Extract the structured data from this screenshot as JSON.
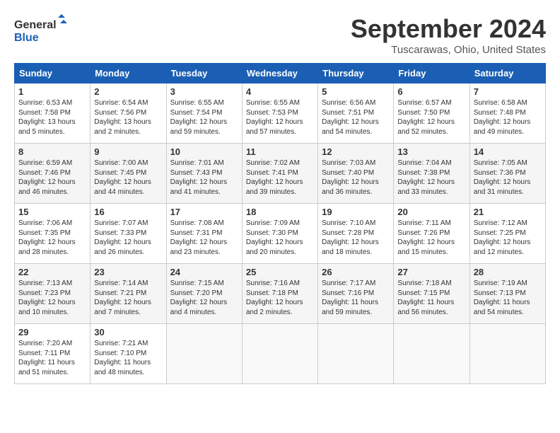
{
  "logo": {
    "line1": "General",
    "line2": "Blue"
  },
  "title": "September 2024",
  "location": "Tuscarawas, Ohio, United States",
  "days_of_week": [
    "Sunday",
    "Monday",
    "Tuesday",
    "Wednesday",
    "Thursday",
    "Friday",
    "Saturday"
  ],
  "weeks": [
    [
      {
        "day": "1",
        "info": "Sunrise: 6:53 AM\nSunset: 7:58 PM\nDaylight: 13 hours\nand 5 minutes."
      },
      {
        "day": "2",
        "info": "Sunrise: 6:54 AM\nSunset: 7:56 PM\nDaylight: 13 hours\nand 2 minutes."
      },
      {
        "day": "3",
        "info": "Sunrise: 6:55 AM\nSunset: 7:54 PM\nDaylight: 12 hours\nand 59 minutes."
      },
      {
        "day": "4",
        "info": "Sunrise: 6:55 AM\nSunset: 7:53 PM\nDaylight: 12 hours\nand 57 minutes."
      },
      {
        "day": "5",
        "info": "Sunrise: 6:56 AM\nSunset: 7:51 PM\nDaylight: 12 hours\nand 54 minutes."
      },
      {
        "day": "6",
        "info": "Sunrise: 6:57 AM\nSunset: 7:50 PM\nDaylight: 12 hours\nand 52 minutes."
      },
      {
        "day": "7",
        "info": "Sunrise: 6:58 AM\nSunset: 7:48 PM\nDaylight: 12 hours\nand 49 minutes."
      }
    ],
    [
      {
        "day": "8",
        "info": "Sunrise: 6:59 AM\nSunset: 7:46 PM\nDaylight: 12 hours\nand 46 minutes."
      },
      {
        "day": "9",
        "info": "Sunrise: 7:00 AM\nSunset: 7:45 PM\nDaylight: 12 hours\nand 44 minutes."
      },
      {
        "day": "10",
        "info": "Sunrise: 7:01 AM\nSunset: 7:43 PM\nDaylight: 12 hours\nand 41 minutes."
      },
      {
        "day": "11",
        "info": "Sunrise: 7:02 AM\nSunset: 7:41 PM\nDaylight: 12 hours\nand 39 minutes."
      },
      {
        "day": "12",
        "info": "Sunrise: 7:03 AM\nSunset: 7:40 PM\nDaylight: 12 hours\nand 36 minutes."
      },
      {
        "day": "13",
        "info": "Sunrise: 7:04 AM\nSunset: 7:38 PM\nDaylight: 12 hours\nand 33 minutes."
      },
      {
        "day": "14",
        "info": "Sunrise: 7:05 AM\nSunset: 7:36 PM\nDaylight: 12 hours\nand 31 minutes."
      }
    ],
    [
      {
        "day": "15",
        "info": "Sunrise: 7:06 AM\nSunset: 7:35 PM\nDaylight: 12 hours\nand 28 minutes."
      },
      {
        "day": "16",
        "info": "Sunrise: 7:07 AM\nSunset: 7:33 PM\nDaylight: 12 hours\nand 26 minutes."
      },
      {
        "day": "17",
        "info": "Sunrise: 7:08 AM\nSunset: 7:31 PM\nDaylight: 12 hours\nand 23 minutes."
      },
      {
        "day": "18",
        "info": "Sunrise: 7:09 AM\nSunset: 7:30 PM\nDaylight: 12 hours\nand 20 minutes."
      },
      {
        "day": "19",
        "info": "Sunrise: 7:10 AM\nSunset: 7:28 PM\nDaylight: 12 hours\nand 18 minutes."
      },
      {
        "day": "20",
        "info": "Sunrise: 7:11 AM\nSunset: 7:26 PM\nDaylight: 12 hours\nand 15 minutes."
      },
      {
        "day": "21",
        "info": "Sunrise: 7:12 AM\nSunset: 7:25 PM\nDaylight: 12 hours\nand 12 minutes."
      }
    ],
    [
      {
        "day": "22",
        "info": "Sunrise: 7:13 AM\nSunset: 7:23 PM\nDaylight: 12 hours\nand 10 minutes."
      },
      {
        "day": "23",
        "info": "Sunrise: 7:14 AM\nSunset: 7:21 PM\nDaylight: 12 hours\nand 7 minutes."
      },
      {
        "day": "24",
        "info": "Sunrise: 7:15 AM\nSunset: 7:20 PM\nDaylight: 12 hours\nand 4 minutes."
      },
      {
        "day": "25",
        "info": "Sunrise: 7:16 AM\nSunset: 7:18 PM\nDaylight: 12 hours\nand 2 minutes."
      },
      {
        "day": "26",
        "info": "Sunrise: 7:17 AM\nSunset: 7:16 PM\nDaylight: 11 hours\nand 59 minutes."
      },
      {
        "day": "27",
        "info": "Sunrise: 7:18 AM\nSunset: 7:15 PM\nDaylight: 11 hours\nand 56 minutes."
      },
      {
        "day": "28",
        "info": "Sunrise: 7:19 AM\nSunset: 7:13 PM\nDaylight: 11 hours\nand 54 minutes."
      }
    ],
    [
      {
        "day": "29",
        "info": "Sunrise: 7:20 AM\nSunset: 7:11 PM\nDaylight: 11 hours\nand 51 minutes."
      },
      {
        "day": "30",
        "info": "Sunrise: 7:21 AM\nSunset: 7:10 PM\nDaylight: 11 hours\nand 48 minutes."
      },
      {
        "day": "",
        "info": ""
      },
      {
        "day": "",
        "info": ""
      },
      {
        "day": "",
        "info": ""
      },
      {
        "day": "",
        "info": ""
      },
      {
        "day": "",
        "info": ""
      }
    ]
  ]
}
